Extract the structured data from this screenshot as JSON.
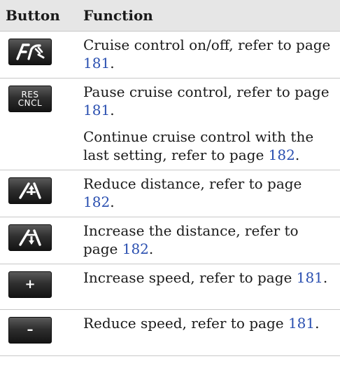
{
  "header": {
    "col_button": "Button",
    "col_function": "Function"
  },
  "rows": [
    {
      "icon": "cruise-control-icon",
      "lines": [
        {
          "text": "Cruise control on/off, refer to page ",
          "page": "181",
          "end": "."
        }
      ]
    },
    {
      "icon": "res-cncl-button",
      "label_top": "RES",
      "label_bottom": "CNCL",
      "lines": [
        {
          "text": "Pause cruise control, refer to page ",
          "page": "181",
          "end": "."
        },
        {
          "text": "Continue cruise control with the last setting, refer to page ",
          "page": "182",
          "end": "."
        }
      ]
    },
    {
      "icon": "reduce-distance-icon",
      "lines": [
        {
          "text": "Reduce distance, refer to page ",
          "page": "182",
          "end": "."
        }
      ]
    },
    {
      "icon": "increase-distance-icon",
      "lines": [
        {
          "text": "Increase the distance, refer to page ",
          "page": "182",
          "end": "."
        }
      ]
    },
    {
      "icon": "plus-button",
      "label": "+",
      "lines": [
        {
          "text": "Increase speed, refer to page ",
          "page": "181",
          "end": "."
        }
      ]
    },
    {
      "icon": "minus-button",
      "label": "–",
      "lines": [
        {
          "text": "Reduce speed, refer to page ",
          "page": "181",
          "end": "."
        }
      ]
    }
  ]
}
